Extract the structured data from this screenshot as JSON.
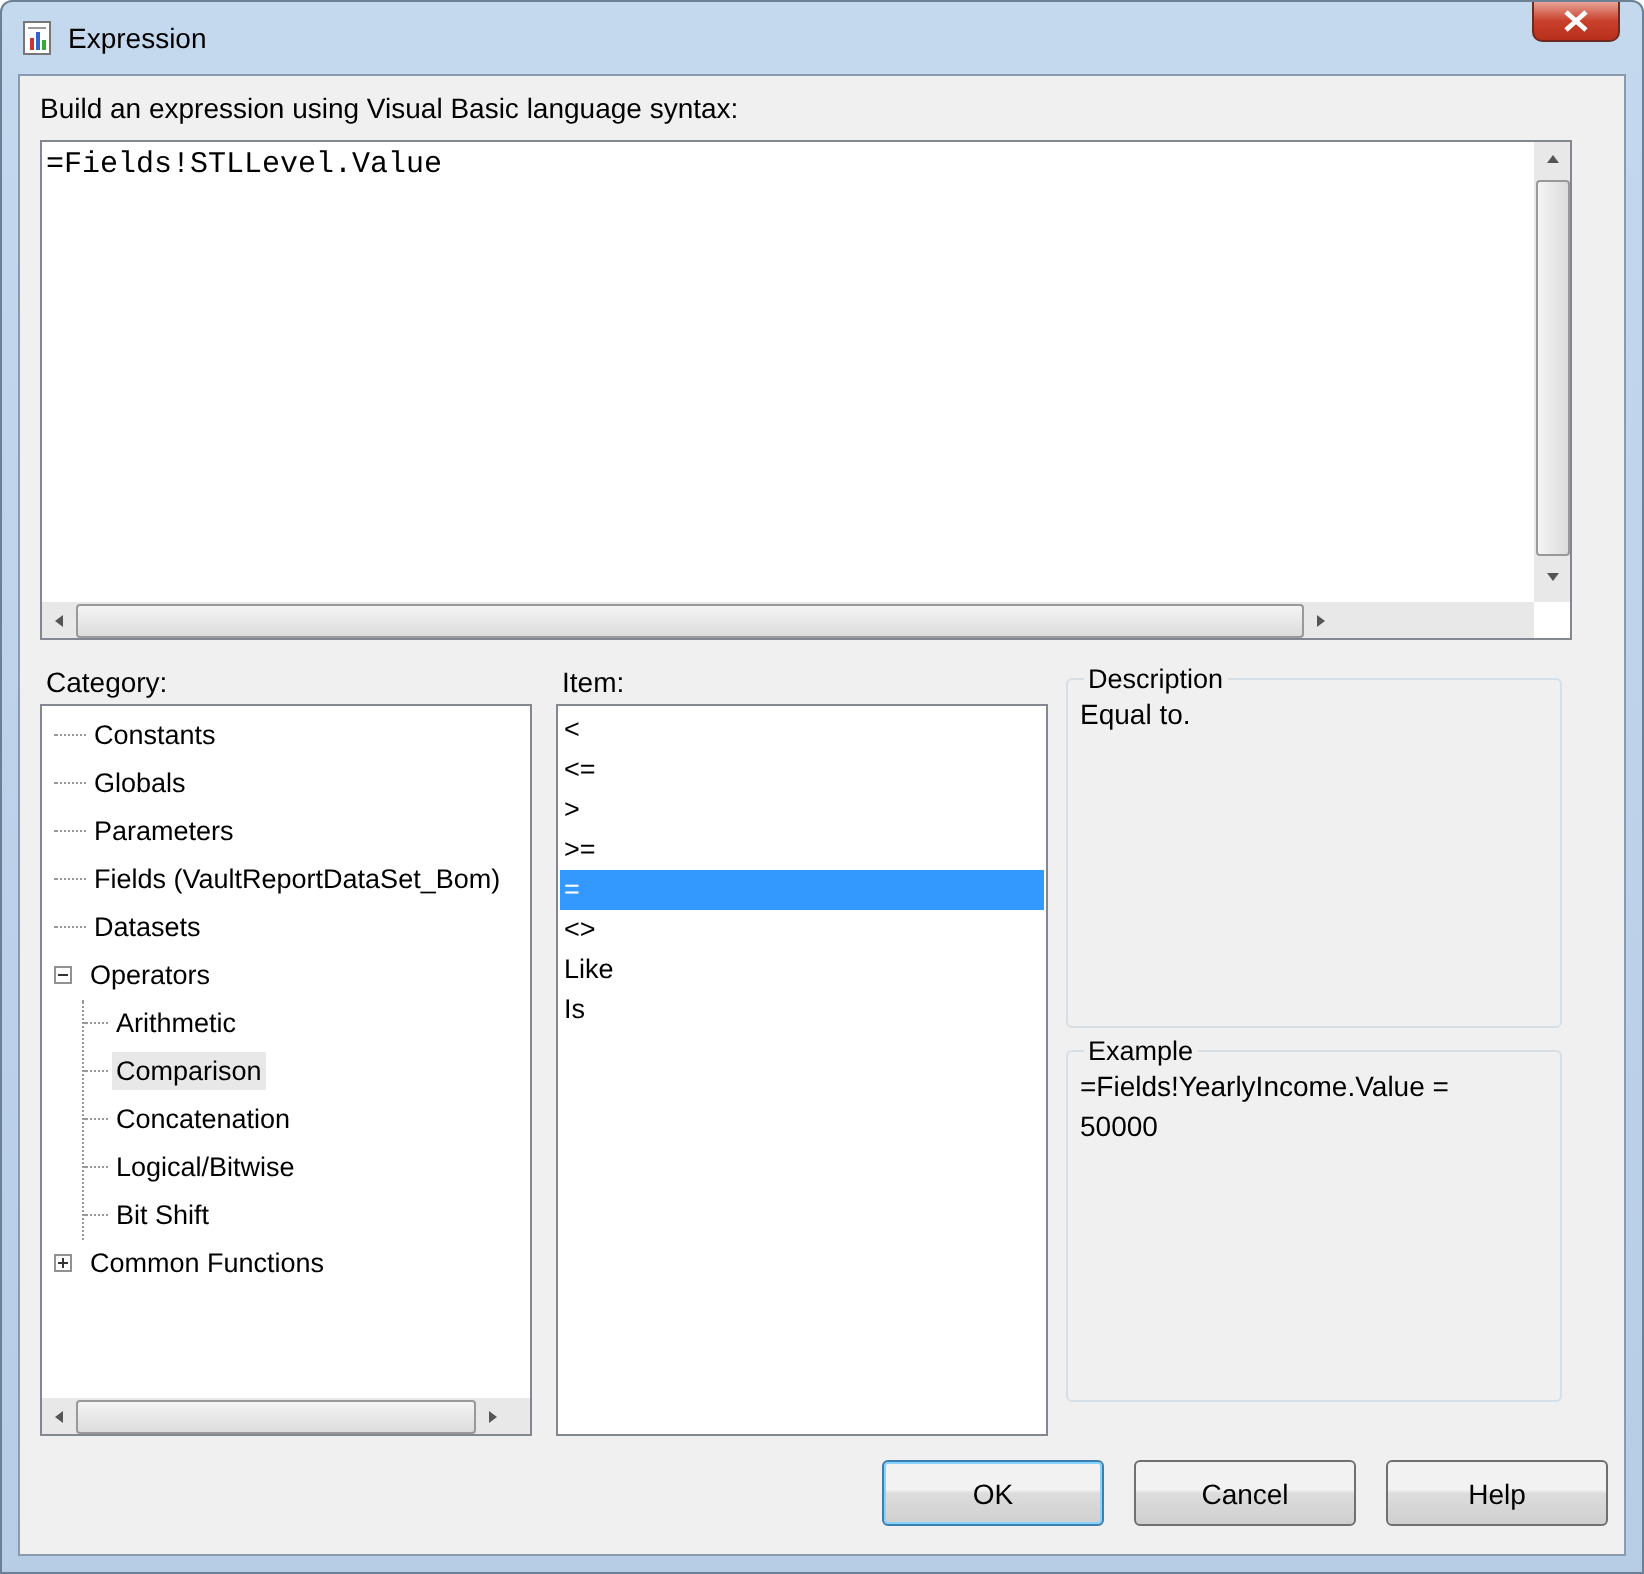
{
  "window": {
    "title": "Expression"
  },
  "prompt": "Build an expression using Visual Basic language syntax:",
  "expression": {
    "value": "=Fields!STLLevel.Value"
  },
  "category": {
    "label": "Category:",
    "tree": [
      {
        "label": "Constants",
        "selected": false
      },
      {
        "label": "Globals",
        "selected": false
      },
      {
        "label": "Parameters",
        "selected": false
      },
      {
        "label": "Fields (VaultReportDataSet_Bom)",
        "selected": false
      },
      {
        "label": "Datasets",
        "selected": false
      },
      {
        "label": "Operators",
        "selected": false,
        "expanded": true,
        "children": [
          {
            "label": "Arithmetic",
            "selected": false
          },
          {
            "label": "Comparison",
            "selected": true
          },
          {
            "label": "Concatenation",
            "selected": false
          },
          {
            "label": "Logical/Bitwise",
            "selected": false
          },
          {
            "label": "Bit Shift",
            "selected": false
          }
        ]
      },
      {
        "label": "Common Functions",
        "selected": false,
        "expanded": false
      }
    ]
  },
  "item": {
    "label": "Item:",
    "items": [
      {
        "label": "<",
        "selected": false
      },
      {
        "label": "<=",
        "selected": false
      },
      {
        "label": ">",
        "selected": false
      },
      {
        "label": ">=",
        "selected": false
      },
      {
        "label": "=",
        "selected": true
      },
      {
        "label": "<>",
        "selected": false
      },
      {
        "label": "Like",
        "selected": false
      },
      {
        "label": "Is",
        "selected": false
      }
    ]
  },
  "description": {
    "title": "Description",
    "text": "Equal to."
  },
  "example": {
    "title": "Example",
    "text": "=Fields!YearlyIncome.Value = 50000"
  },
  "buttons": [
    {
      "label": "OK",
      "default": true
    },
    {
      "label": "Cancel",
      "default": false
    },
    {
      "label": "Help",
      "default": false
    }
  ]
}
